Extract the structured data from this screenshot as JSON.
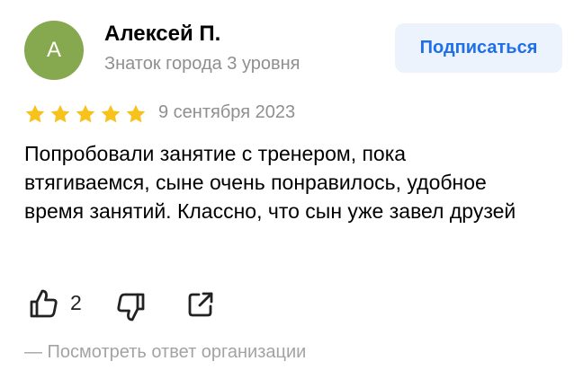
{
  "author": {
    "initial": "А",
    "name": "Алексей П.",
    "level": "Знаток города 3 уровня",
    "avatar_color": "#86a94f"
  },
  "subscribe_label": "Подписаться",
  "review": {
    "rating": 5,
    "rating_max": 5,
    "date": "9 сентября 2023",
    "text": "Попробовали занятие с тренером, пока втягиваемся, сыне очень понравилось, удобное время занятий. Классно, что сын уже завел друзей"
  },
  "actions": {
    "like_icon": "thumbs-up-icon",
    "like_count": "2",
    "dislike_icon": "thumbs-down-icon",
    "share_icon": "share-icon"
  },
  "org_reply_label": "— Посмотреть ответ организации",
  "colors": {
    "accent": "#1e6fe8",
    "button_bg": "#edf3fd",
    "star": "#f8c21d",
    "muted_text": "#8f8f8f"
  }
}
